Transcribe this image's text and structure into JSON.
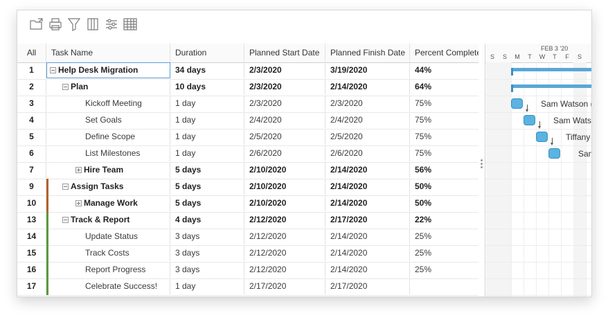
{
  "toolbar": {
    "icons": [
      "open-file-icon",
      "print-icon",
      "filter-icon",
      "columns-icon",
      "settings-sliders-icon",
      "table-icon"
    ]
  },
  "columns": {
    "id": "All",
    "name": "Task Name",
    "duration": "Duration",
    "start": "Planned Start Date",
    "finish": "Planned Finish Date",
    "percent": "Percent Complete"
  },
  "rows": [
    {
      "id": "1",
      "name": "Help Desk Migration",
      "duration": "34 days",
      "start": "2/3/2020",
      "finish": "3/19/2020",
      "percent": "44%"
    },
    {
      "id": "2",
      "name": "Plan",
      "duration": "10 days",
      "start": "2/3/2020",
      "finish": "2/14/2020",
      "percent": "64%"
    },
    {
      "id": "3",
      "name": "Kickoff Meeting",
      "duration": "1 day",
      "start": "2/3/2020",
      "finish": "2/3/2020",
      "percent": "75%"
    },
    {
      "id": "4",
      "name": "Set Goals",
      "duration": "1 day",
      "start": "2/4/2020",
      "finish": "2/4/2020",
      "percent": "75%"
    },
    {
      "id": "5",
      "name": "Define Scope",
      "duration": "1 day",
      "start": "2/5/2020",
      "finish": "2/5/2020",
      "percent": "75%"
    },
    {
      "id": "6",
      "name": "List Milestones",
      "duration": "1 day",
      "start": "2/6/2020",
      "finish": "2/6/2020",
      "percent": "75%"
    },
    {
      "id": "7",
      "name": "Hire Team",
      "duration": "5 days",
      "start": "2/10/2020",
      "finish": "2/14/2020",
      "percent": "56%"
    },
    {
      "id": "9",
      "name": "Assign Tasks",
      "duration": "5 days",
      "start": "2/10/2020",
      "finish": "2/14/2020",
      "percent": "50%"
    },
    {
      "id": "10",
      "name": "Manage Work",
      "duration": "5 days",
      "start": "2/10/2020",
      "finish": "2/14/2020",
      "percent": "50%"
    },
    {
      "id": "13",
      "name": "Track & Report",
      "duration": "4 days",
      "start": "2/12/2020",
      "finish": "2/17/2020",
      "percent": "22%"
    },
    {
      "id": "14",
      "name": "Update Status",
      "duration": "3 days",
      "start": "2/12/2020",
      "finish": "2/14/2020",
      "percent": "25%"
    },
    {
      "id": "15",
      "name": "Track Costs",
      "duration": "3 days",
      "start": "2/12/2020",
      "finish": "2/14/2020",
      "percent": "25%"
    },
    {
      "id": "16",
      "name": "Report Progress",
      "duration": "3 days",
      "start": "2/12/2020",
      "finish": "2/14/2020",
      "percent": "25%"
    },
    {
      "id": "17",
      "name": "Celebrate Success!",
      "duration": "1 day",
      "start": "2/17/2020",
      "finish": "2/17/2020",
      "percent": ""
    }
  ],
  "status_colors": {
    "orange": "#b5622a",
    "green": "#5a9a3c"
  },
  "gantt": {
    "month": "FEB 3 '20",
    "days": [
      "S",
      "S",
      "M",
      "T",
      "W",
      "T",
      "F",
      "S"
    ],
    "labels": [
      "Sam Watson (",
      "Sam Watso",
      "Tiffany",
      "San"
    ]
  }
}
